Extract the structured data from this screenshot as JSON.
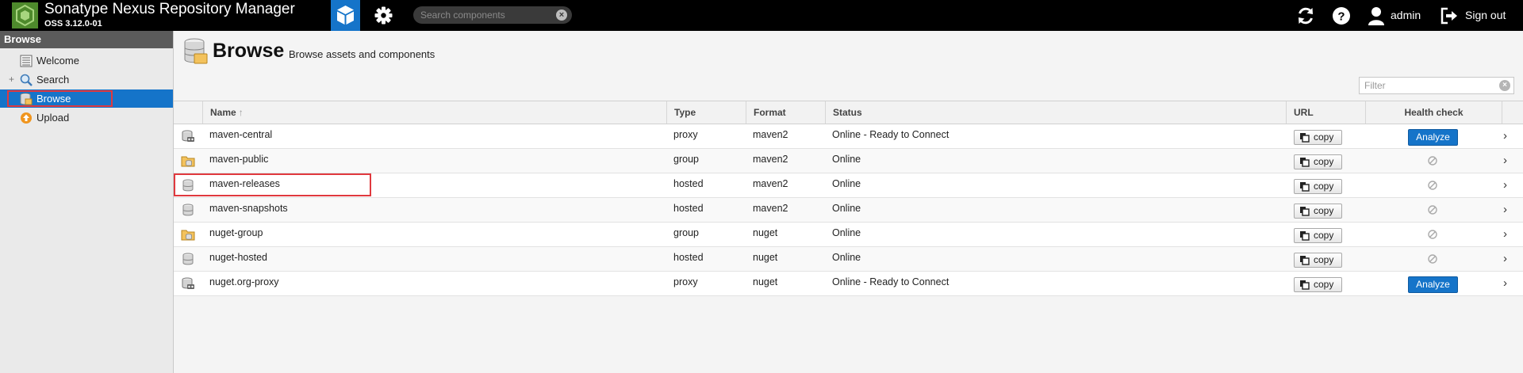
{
  "app": {
    "title": "Sonatype Nexus Repository Manager",
    "version": "OSS 3.12.0-01",
    "brand_color": "#1574c9",
    "logo_color": "#4e8a2c"
  },
  "topbar": {
    "browse_mode_icon": "cube-icon",
    "admin_mode_icon": "gear-icon",
    "search": {
      "placeholder": "Search components",
      "value": ""
    },
    "refresh_icon": "refresh-icon",
    "help_icon": "help-icon",
    "user": {
      "name": "admin",
      "icon": "user-icon"
    },
    "signout": {
      "label": "Sign out",
      "icon": "signout-icon"
    }
  },
  "sidebar": {
    "header": "Browse",
    "items": [
      {
        "label": "Welcome",
        "icon": "list-icon",
        "selected": false
      },
      {
        "label": "Search",
        "icon": "magnifier-icon",
        "expandable": true,
        "expander": "+",
        "selected": false
      },
      {
        "label": "Browse",
        "icon": "database-icon",
        "selected": true
      },
      {
        "label": "Upload",
        "icon": "upload-icon",
        "selected": false
      }
    ]
  },
  "main": {
    "title": "Browse",
    "subtitle": "Browse assets and components",
    "filter": {
      "placeholder": "Filter",
      "value": ""
    },
    "columns": {
      "name": "Name",
      "name_sort": "↑",
      "type": "Type",
      "format": "Format",
      "status": "Status",
      "url": "URL",
      "health": "Health check"
    },
    "copy_label": "copy",
    "analyze_label": "Analyze",
    "rows": [
      {
        "name": "maven-central",
        "type": "proxy",
        "format": "maven2",
        "status": "Online - Ready to Connect",
        "icon": "proxy-repo-icon",
        "health": "analyze"
      },
      {
        "name": "maven-public",
        "type": "group",
        "format": "maven2",
        "status": "Online",
        "icon": "group-repo-icon",
        "health": "na"
      },
      {
        "name": "maven-releases",
        "type": "hosted",
        "format": "maven2",
        "status": "Online",
        "icon": "hosted-repo-icon",
        "health": "na",
        "highlighted": true
      },
      {
        "name": "maven-snapshots",
        "type": "hosted",
        "format": "maven2",
        "status": "Online",
        "icon": "hosted-repo-icon",
        "health": "na"
      },
      {
        "name": "nuget-group",
        "type": "group",
        "format": "nuget",
        "status": "Online",
        "icon": "group-repo-icon",
        "health": "na"
      },
      {
        "name": "nuget-hosted",
        "type": "hosted",
        "format": "nuget",
        "status": "Online",
        "icon": "hosted-repo-icon",
        "health": "na"
      },
      {
        "name": "nuget.org-proxy",
        "type": "proxy",
        "format": "nuget",
        "status": "Online - Ready to Connect",
        "icon": "proxy-repo-icon",
        "health": "analyze"
      }
    ]
  },
  "colors": {
    "selection": "#1574c9",
    "annotation_red": "#e0393e",
    "topbar": "#000000",
    "sidebar_header": "#5b5b5b"
  }
}
